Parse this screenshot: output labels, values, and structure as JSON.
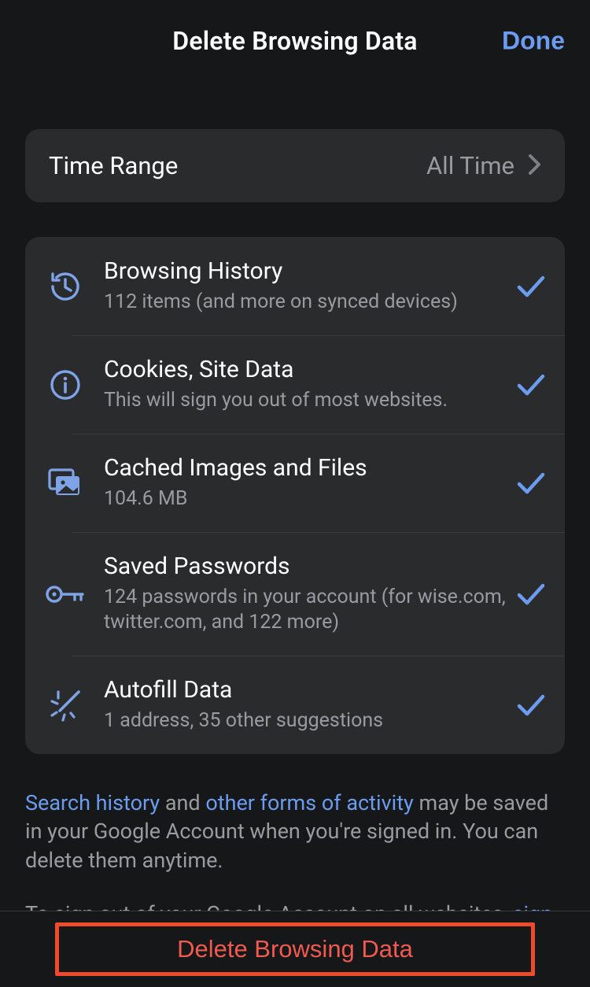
{
  "header": {
    "title": "Delete Browsing Data",
    "done": "Done"
  },
  "timeRange": {
    "label": "Time Range",
    "value": "All Time"
  },
  "items": [
    {
      "title": "Browsing History",
      "sub": "112 items (and more on synced devices)"
    },
    {
      "title": "Cookies, Site Data",
      "sub": "This will sign you out of most websites."
    },
    {
      "title": "Cached Images and Files",
      "sub": "104.6 MB"
    },
    {
      "title": "Saved Passwords",
      "sub": "124 passwords in your account (for wise.com, twitter.com, and 122 more)"
    },
    {
      "title": "Autofill Data",
      "sub": "1 address, 35 other suggestions"
    }
  ],
  "footer": {
    "link1": "Search history",
    "middle1": " and ",
    "link2": "other forms of activity",
    "rest1": " may be saved in your Google Account when you're signed in. You can delete them anytime.",
    "line2a": "To sign out of your Google Account on all websites, ",
    "link3": "sign out"
  },
  "action": {
    "delete": "Delete Browsing Data"
  }
}
